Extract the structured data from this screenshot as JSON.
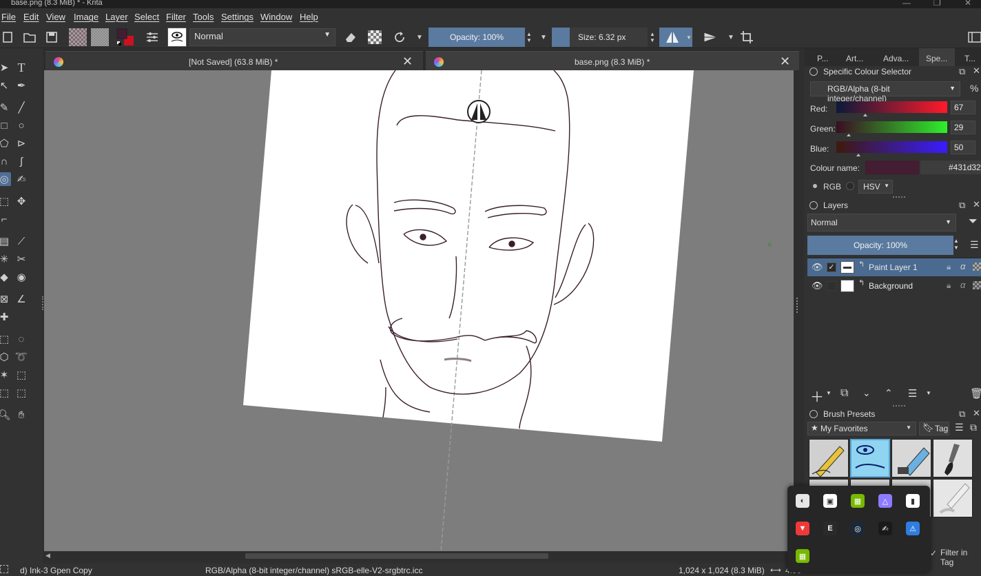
{
  "window": {
    "title": "base.png (8.3 MiB) * - Krita",
    "minimize_glyph": "—",
    "restore_glyph": "❐",
    "close_glyph": "✕"
  },
  "menu": [
    "File",
    "Edit",
    "View",
    "Image",
    "Layer",
    "Select",
    "Filter",
    "Tools",
    "Settings",
    "Window",
    "Help"
  ],
  "toolbar": {
    "blend_mode": "Normal",
    "opacity_label": "Opacity: 100%",
    "size_label": "Size: 6.32 px",
    "fg_color": "#431d32",
    "bg_color": "#cc1122",
    "icons": [
      "new-document-icon",
      "open-document-icon",
      "save-icon",
      "gradient-icon",
      "pattern-icon",
      "color-swatch-icon",
      "brush-settings-icon",
      "brush-preset-icon",
      "eraser-icon",
      "alpha-lock-icon",
      "reload-preset-icon",
      "mirror-horizontal-icon",
      "mirror-vertical-icon",
      "wrap-around-icon"
    ]
  },
  "tabs": [
    {
      "label": "[Not Saved]  (63.8 MiB) *",
      "close": "✕"
    },
    {
      "label": "base.png (8.3 MiB) *",
      "close": "✕"
    }
  ],
  "statusbar": {
    "brush": "d) Ink-3 Gpen Copy",
    "colorspace": "RGB/Alpha (8-bit integer/channel)  sRGB-elle-V2-srgbtrc.icc",
    "image_size": "1,024 x 1,024 (8.3 MiB)",
    "zoom": "4.90"
  },
  "docker": {
    "tabs": [
      "P...",
      "Art...",
      "Adva...",
      "Spe...",
      "T..."
    ],
    "specific_color": {
      "title": "Specific Colour Selector",
      "colorspace": "RGB/Alpha (8-bit integer/channel)",
      "percent_glyph": "%",
      "channels": [
        {
          "label": "Red:",
          "value": "67",
          "from": "#0b1a3a",
          "to": "#ff1a2a",
          "pos": 0.263
        },
        {
          "label": "Green:",
          "value": "29",
          "from": "#3a0d22",
          "to": "#2ef02a",
          "pos": 0.114
        },
        {
          "label": "Blue:",
          "value": "50",
          "from": "#3e1a0a",
          "to": "#3a1cff",
          "pos": 0.196
        }
      ],
      "colour_name_label": "Colour name:",
      "colour_hex": "#431d32",
      "rgb_label": "RGB",
      "hsv_label": "HSV"
    },
    "layers": {
      "title": "Layers",
      "blend_mode": "Normal",
      "opacity_label": "Opacity:  100%",
      "items": [
        {
          "name": "Paint Layer 1",
          "selected": true,
          "checked": "✓"
        },
        {
          "name": "Background",
          "selected": false,
          "checked": ""
        }
      ],
      "alpha_glyph": "α"
    },
    "brush_presets": {
      "title": "Brush Presets",
      "tag_filter": "My Favorites",
      "tag_label": "Tag",
      "filter_in_tag": "Filter in Tag"
    }
  },
  "tray": {
    "icons": [
      {
        "name": "creative-cloud-icon",
        "color": "#e6e6e6"
      },
      {
        "name": "discord-icon",
        "color": "#ffffff"
      },
      {
        "name": "nvidia-icon",
        "color": "#76b900"
      },
      {
        "name": "proton-icon",
        "color": "#8c7bff"
      },
      {
        "name": "patreon-icon",
        "color": "#ffffff"
      },
      {
        "name": "vivaldi-icon",
        "color": "#ef3939"
      },
      {
        "name": "epic-games-icon",
        "color": "#2a2a2a"
      },
      {
        "name": "steam-icon",
        "color": "#1b2838"
      },
      {
        "name": "xp-pen-icon",
        "color": "#1a1a1a"
      },
      {
        "name": "windows-security-icon",
        "color": "#2f7de1"
      },
      {
        "name": "nvidia-geforce-icon",
        "color": "#76b900"
      }
    ]
  }
}
